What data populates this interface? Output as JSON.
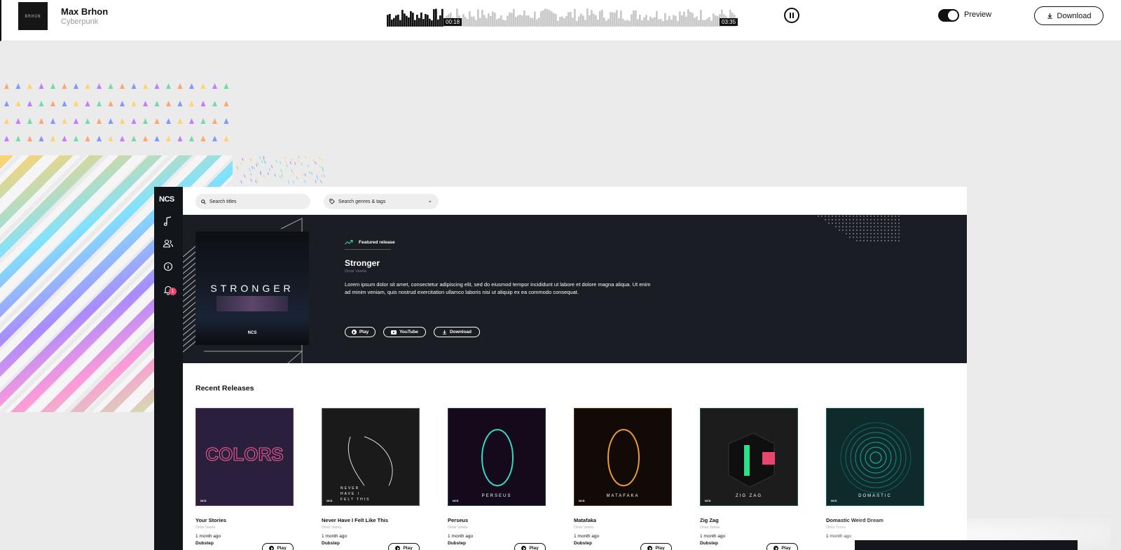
{
  "player": {
    "artist": "Max Brhon",
    "album": "Cyberpunk",
    "thumb_text": "BRHON",
    "time_elapsed": "00:18",
    "time_total": "03:35",
    "progress": 0.16,
    "preview_label": "Preview",
    "preview_on": true,
    "download_label": "Download",
    "pause_icon": "pause-icon"
  },
  "app": {
    "logo": "NCS",
    "search_placeholder": "Search titles",
    "genre_placeholder": "Search genres & tags",
    "notification_count": "1",
    "sidebar_icons": [
      "music-note-icon",
      "users-icon",
      "info-icon",
      "bell-icon"
    ],
    "featured": {
      "label": "Featured release",
      "title": "Stronger",
      "artist": "Omar Varela",
      "cover_text": "STRONGER",
      "cover_logo": "NCS",
      "description": "Lorem ipsum dolor sit amet, consectetur adipiscing elit, sed do eiusmod tempor incididunt ut labore et dolore magna aliqua. Ut enim ad minim veniam, quis nostrud exercitation ullamco laboris nisi ut aliquip ex ea commodo consequat.",
      "play_label": "Play",
      "youtube_label": "YouTube",
      "download_label": "Download"
    },
    "recent_title": "Recent Releases",
    "releases": [
      {
        "title": "Your Stories",
        "artist": "Omar Varela",
        "ago": "1 month ago",
        "genre": "Dubstep",
        "play_label": "Play",
        "art_text": "COLORS",
        "bg": "#2a1f3d",
        "accent": "#ff5fa2"
      },
      {
        "title": "Never Have I Felt Like This",
        "artist": "Omar Varela",
        "ago": "1 month ago",
        "genre": "Dubstep",
        "play_label": "Play",
        "art_text": "NEVER HAVE I FELT THIS",
        "bg": "#1a1a1a",
        "accent": "#ffffff"
      },
      {
        "title": "Perseus",
        "artist": "Omar Varela",
        "ago": "1 month ago",
        "genre": "Dubstep",
        "play_label": "Play",
        "art_text": "PERSEUS",
        "bg": "#140a1c",
        "accent": "#3ad6c3"
      },
      {
        "title": "Matafaka",
        "artist": "Omar Varela",
        "ago": "1 month ago",
        "genre": "Dubstep",
        "play_label": "Play",
        "art_text": "MATAFAKA",
        "bg": "#120a06",
        "accent": "#e89a3c"
      },
      {
        "title": "Zig Zag",
        "artist": "Omar Varela",
        "ago": "1 month ago",
        "genre": "Dubstep",
        "play_label": "Play",
        "art_text": "ZIG ZAG",
        "bg": "#1c1c1c",
        "accent": "#2fe08a"
      },
      {
        "title": "Domastic Weird Dream",
        "artist": "Omar Varela",
        "ago": "1 month ago",
        "genre": "",
        "play_label": "",
        "art_text": "DOMASTIC",
        "bg": "#0e2a2a",
        "accent": "#1fd3c4"
      }
    ]
  },
  "colors": {
    "sidebar_bg": "#12151a",
    "hero_bg": "#1a1d23",
    "badge": "#e8466f",
    "trend_green": "#3ad69a"
  }
}
